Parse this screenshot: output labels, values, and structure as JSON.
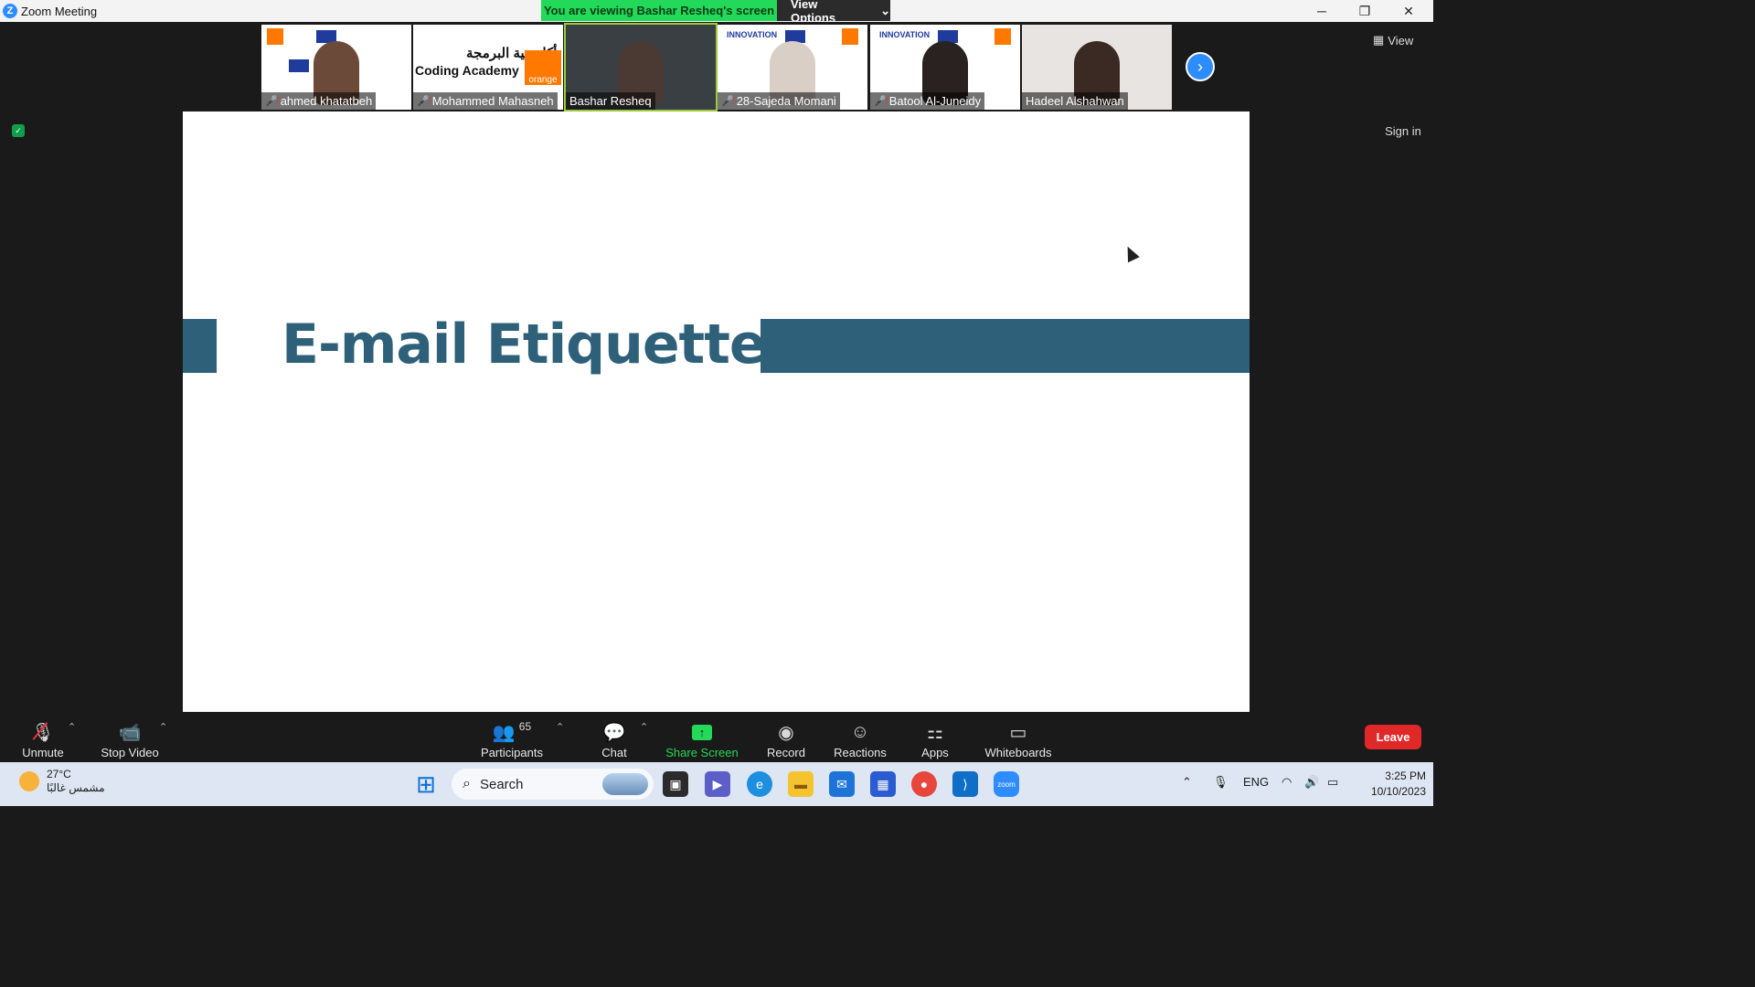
{
  "window": {
    "title": "Zoom Meeting"
  },
  "banner": {
    "viewing": "You are viewing Bashar Resheq's screen",
    "view_options": "View Options"
  },
  "participants_strip": [
    {
      "name": "ahmed khatatbeh",
      "muted": true
    },
    {
      "name": "Mohammed Mahasneh",
      "muted": true
    },
    {
      "name": "Bashar Resheq",
      "muted": false
    },
    {
      "name": "28-Sajeda Momani",
      "muted": true
    },
    {
      "name": "Batool Al-Juneidy",
      "muted": true
    },
    {
      "name": "Hadeel Alshahwan",
      "muted": false
    }
  ],
  "tile_text": {
    "coding_ar": "أكاديمية البرمجة",
    "coding_en": "Coding Academy",
    "orange": "orange",
    "innovation": "INNOVATION"
  },
  "top_right": {
    "view": "View",
    "sign_in": "Sign in"
  },
  "slide": {
    "headline": "E-mail Etiquette"
  },
  "toolbar": {
    "unmute": "Unmute",
    "stop_video": "Stop Video",
    "participants": "Participants",
    "participants_count": "65",
    "chat": "Chat",
    "share_screen": "Share Screen",
    "record": "Record",
    "reactions": "Reactions",
    "apps": "Apps",
    "whiteboards": "Whiteboards",
    "leave": "Leave"
  },
  "taskbar": {
    "temperature": "27°C",
    "weather_desc": "مشمس غالبًا",
    "search": "Search",
    "language": "ENG",
    "time": "3:25 PM",
    "date": "10/10/2023"
  }
}
